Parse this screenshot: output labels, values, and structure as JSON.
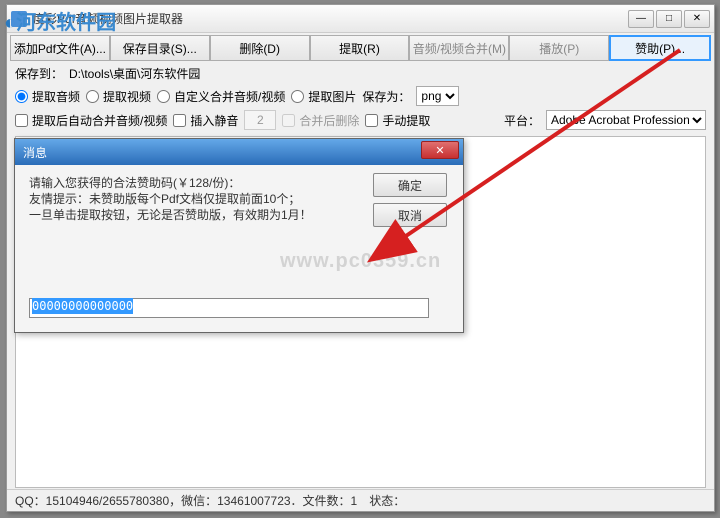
{
  "window": {
    "title": "度彩Pdf音频视频图片提取器"
  },
  "toolbar": {
    "add": "添加Pdf文件(A)...",
    "savedir": "保存目录(S)...",
    "delete": "删除(D)",
    "extract": "提取(R)",
    "merge": "音频/视频合并(M)",
    "play": "播放(P)",
    "sponsor": "赞助(P)..."
  },
  "row1": {
    "saveto_label": "保存到：",
    "saveto_path": "D:\\tools\\桌面\\河东软件园",
    "opt_audio": "提取音频",
    "opt_video": "提取视频",
    "opt_custom": "自定义合并音频/视频",
    "opt_image": "提取图片",
    "saveas_label": "保存为：",
    "saveas_value": "png"
  },
  "row2": {
    "chk_merge_after": "提取后自动合并音频/视频",
    "chk_silence": "插入静音",
    "spinner_value": "2",
    "chk_del_after": "合并后删除",
    "chk_manual": "手动提取",
    "platform_label": "平台：",
    "platform_value": "Adobe Acrobat Professiona"
  },
  "dialog": {
    "title": "消息",
    "line1": "请输入您获得的合法赞助码(￥128/份)：",
    "line2": "友情提示：未赞助版每个Pdf文档仅提取前面10个；",
    "line3": "一旦单击提取按钮，无论是否赞助版，有效期为1月！",
    "input_value": "00000000000000",
    "ok": "确定",
    "cancel": "取消"
  },
  "status": {
    "text": "QQ：15104946/2655780380，微信：13461007723．文件数：1　状态："
  },
  "watermark": {
    "brand": "河东软件园",
    "url": "www.pc0359.cn"
  }
}
